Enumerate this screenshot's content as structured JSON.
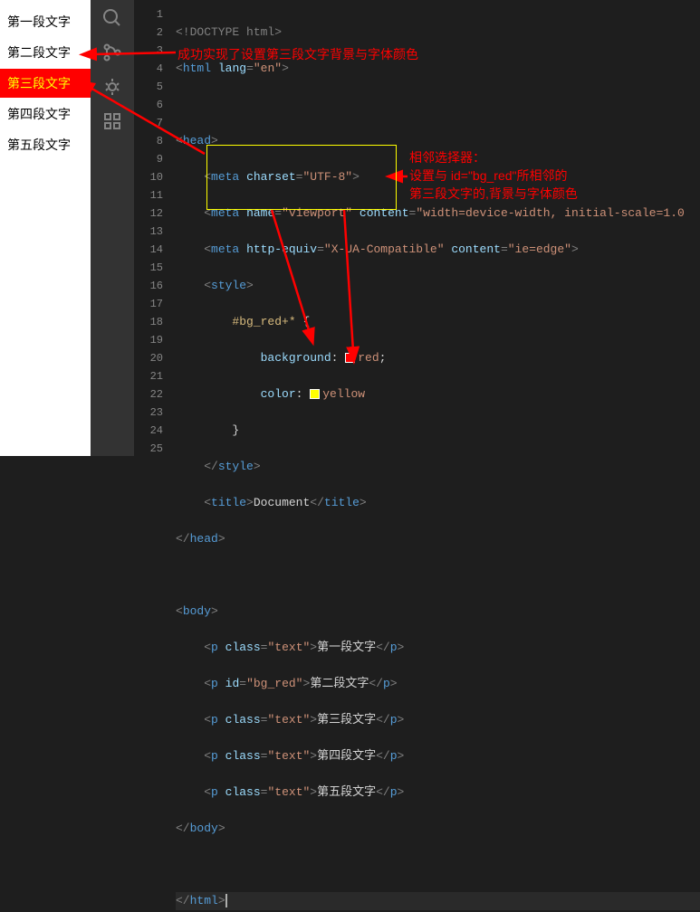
{
  "preview": {
    "p1": "第一段文字",
    "p2": "第二段文字",
    "p3": "第三段文字",
    "p4": "第四段文字",
    "p5": "第五段文字"
  },
  "gutter": {
    "l1": "1",
    "l2": "2",
    "l3": "3",
    "l4": "4",
    "l5": "5",
    "l6": "6",
    "l7": "7",
    "l8": "8",
    "l9": "9",
    "l10": "10",
    "l11": "11",
    "l12": "12",
    "l13": "13",
    "l14": "14",
    "l15": "15",
    "l16": "16",
    "l17": "17",
    "l18": "18",
    "l19": "19",
    "l20": "20",
    "l21": "21",
    "l22": "22",
    "l23": "23",
    "l24": "24",
    "l25": "25"
  },
  "code": {
    "doctype": "<!DOCTYPE html>",
    "html_open_a": "<",
    "html": "html",
    "space": " ",
    "lang": "lang",
    "eq": "=",
    "en": "\"en\"",
    "gt": ">",
    "head_open": "head",
    "meta": "meta",
    "charset": "charset",
    "utf8": "\"UTF-8\"",
    "name_attr": "name",
    "viewport": "\"viewport\"",
    "content": "content",
    "vp_val": "\"width=device-width, initial-scale=1.0",
    "http_equiv": "http-equiv",
    "xua": "\"X-UA-Compatible\"",
    "ie": "\"ie=edge\"",
    "style": "style",
    "selector": "#bg_red+*",
    "brace_o": " {",
    "brace_c": "}",
    "bg_prop": "background",
    "bg_val": "red",
    "semi": ";",
    "color_prop": "color",
    "color_val": "yellow",
    "title": "title",
    "doc": "Document",
    "body": "body",
    "p": "p",
    "class": "class",
    "text_cls": "\"text\"",
    "id": "id",
    "bgred": "\"bg_red\"",
    "p1": "第一段文字",
    "p2": "第二段文字",
    "p3": "第三段文字",
    "p4": "第四段文字",
    "p5": "第五段文字",
    "lt": "<",
    "slash": "</",
    "close": ">"
  },
  "annot": {
    "top": "成功实现了设置第三段文字背景与字体颜色",
    "r1": "相邻选择器：",
    "r2": "设置与 id=\"bg_red\"所相邻的",
    "r3": "第三段文字的,背景与字体颜色"
  }
}
